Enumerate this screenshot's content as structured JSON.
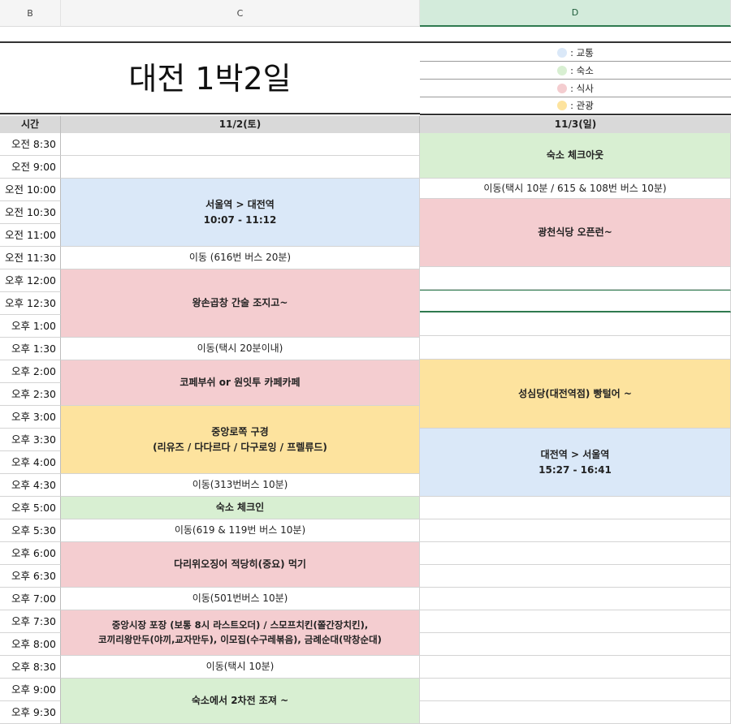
{
  "columns": {
    "b": "B",
    "c": "C",
    "d": "D"
  },
  "title": "대전 1박2일",
  "legend": [
    {
      "label": ": 교통",
      "color": "#dae8f8"
    },
    {
      "label": ": 숙소",
      "color": "#d8efd2"
    },
    {
      "label": ": 식사",
      "color": "#f4cdd0"
    },
    {
      "label": ": 관광",
      "color": "#fde39e"
    }
  ],
  "header": {
    "time": "시간",
    "day1": "11/2(토)",
    "day2": "11/3(일)"
  },
  "times": [
    "오전 8:30",
    "오전 9:00",
    "오전 10:00",
    "오전 10:30",
    "오전 11:00",
    "오전 11:30",
    "오후 12:00",
    "오후 12:30",
    "오후 1:00",
    "오후 1:30",
    "오후 2:00",
    "오후 2:30",
    "오후 3:00",
    "오후 3:30",
    "오후 4:00",
    "오후 4:30",
    "오후 5:00",
    "오후 5:30",
    "오후 6:00",
    "오후 6:30",
    "오후 7:00",
    "오후 7:30",
    "오후 8:00",
    "오후 8:30",
    "오후 9:00",
    "오후 9:30"
  ],
  "day1": {
    "train_go": {
      "line1": "서울역 > 대전역",
      "line2": "10:07 - 11:12"
    },
    "move1": "이동 (616번 버스 20분)",
    "lunch": "왕손곱창 간술 조지고~",
    "move2": "이동(택시 20분이내)",
    "cafe": "코페부쉬 or 원잇투 카페카페",
    "tour": {
      "line1": "중앙로쪽 구경",
      "line2": "(리유즈 / 다다르다 / 다구로잉 / 프렐류드)"
    },
    "move3": "이동(313번버스 10분)",
    "checkin": "숙소 체크인",
    "move4": "이동(619 & 119번 버스 10분)",
    "dinner": "다리위오징어 적당히(중요) 먹기",
    "move5": "이동(501번버스 10분)",
    "market": {
      "line1": "중앙시장 포장 (보통 8시 라스트오더) / 스모프치킨(쫄간장치킨),",
      "line2": "코끼리왕만두(야끼,교자만두), 이모집(수구레볶음), 금례순대(막창순대)"
    },
    "move6": "이동(택시 10분)",
    "second": "숙소에서 2차전 조져 ~"
  },
  "day2": {
    "checkout": "숙소 체크아웃",
    "move1": "이동(택시 10분 / 615 & 108번 버스 10분)",
    "brunch": "광천식당 오픈런~",
    "bakery": "성심당(대전역점) 빵털어 ~",
    "train_back": {
      "line1": "대전역 > 서울역",
      "line2": "15:27 - 16:41"
    }
  }
}
